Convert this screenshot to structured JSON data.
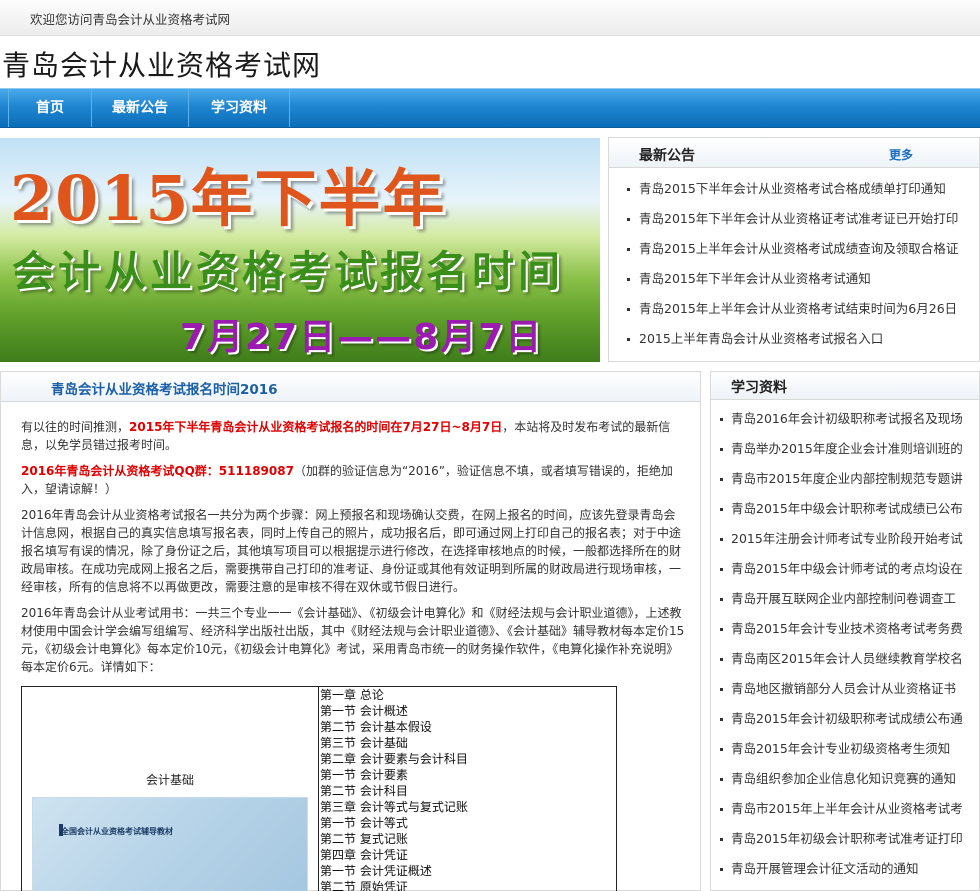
{
  "topbar": {
    "welcome": "欢迎您访问青岛会计从业资格考试网"
  },
  "site": {
    "title": "青岛会计从业资格考试网"
  },
  "nav": {
    "items": [
      "首页",
      "最新公告",
      "学习资料"
    ]
  },
  "banner": {
    "year_text": "2015年下半年",
    "sub_text": "会计从业资格考试报名时间",
    "date_text": "7月27日——8月7日"
  },
  "notice": {
    "title": "最新公告",
    "more": "更多",
    "items": [
      "青岛2015下半年会计从业资格考试合格成绩单打印通知",
      "青岛2015年下半年会计从业资格证考试准考证已开始打印",
      "青岛2015上半年会计从业资格考试成绩查询及领取合格证",
      "青岛2015年下半年会计从业资格考试通知",
      "青岛2015年上半年会计从业资格考试结束时间为6月26日",
      "2015上半年青岛会计从业资格考试报名入口"
    ]
  },
  "article": {
    "title": "青岛会计从业资格考试报名时间2016",
    "p1_pre": "有以往的时间推测，",
    "p1_red": "2015年下半年青岛会计从业资格考试报名的时间在7月27日~8月7日",
    "p1_post": "，本站将及时发布考试的最新信息，以免学员错过报考时间。",
    "p2_red": "2016年青岛会计从资格考试QQ群：511189087",
    "p2_post": "（加群的验证信息为“2016”，验证信息不填，或者填写错误的，拒绝加入，望请谅解！）",
    "p3": "2016年青岛会计从业资格考试报名一共分为两个步骤：网上预报名和现场确认交费，在网上报名的时间，应该先登录青岛会计信息网，根据自己的真实信息填写报名表，同时上传自己的照片，成功报名后，即可通过网上打印自己的报名表；对于中途报名填写有误的情况，除了身份证之后，其他填写项目可以根据提示进行修改，在选择审核地点的时候，一般都选择所在的财政局审核。在成功完成网上报名之后，需要携带自己打印的准考证、身份证或其他有效证明到所属的财政局进行现场审核，一经审核，所有的信息将不以再做更改，需要注意的是审核不得在双休或节假日进行。",
    "p4": "2016年青岛会计从业考试用书：一共三个专业一一《会计基础》、《初级会计电算化》和《财经法规与会计职业道德》，上述教材使用中国会计学会编写组编写、经济科学出版社出版，其中《财经法规与会计职业道德》、《会计基础》辅导教材每本定价15元，《初级会计电算化》每本定价10元，《初级会计电算化》考试，采用青岛市统一的财务操作软件，《电算化操作补充说明》每本定价6元。详情如下：",
    "book": {
      "name": "会计基础",
      "cover_label": "全国会计从业资格考试辅导教材",
      "toc": [
        "第一章 总论",
        "第一节 会计概述",
        "第二节 会计基本假设",
        "第三节 会计基础",
        "第二章 会计要素与会计科目",
        "第一节 会计要素",
        "第二节 会计科目",
        "第三章 会计等式与复式记账",
        "第一节 会计等式",
        "第二节 复式记账",
        "第四章 会计凭证",
        "第一节 会计凭证概述",
        "第二节 原始凭证"
      ]
    }
  },
  "study": {
    "title": "学习资料",
    "items": [
      "青岛2016年会计初级职称考试报名及现场",
      "青岛举办2015年度企业会计准则培训班的",
      "青岛市2015年度企业内部控制规范专题讲",
      "青岛2015年中级会计职称考试成绩已公布",
      "2015年注册会计师考试专业阶段开始考试",
      "青岛2015年中级会计师考试的考点均设在",
      "青岛开展互联网企业内部控制问卷调查工",
      "青岛2015年会计专业技术资格考试考务费",
      "青岛南区2015年会计人员继续教育学校名",
      "青岛地区撤销部分人员会计从业资格证书",
      "青岛2015年会计初级职称考试成绩公布通",
      "青岛2015年会计专业初级资格考生须知",
      "青岛组织参加企业信息化知识竞赛的通知",
      "青岛市2015年上半年会计从业资格考试考",
      "青岛2015年初级会计职称考试准考证打印",
      "青岛开展管理会计征文活动的通知"
    ]
  },
  "colors": {
    "nav_blue": "#1f86d2",
    "link_blue": "#1b6fc2",
    "title_blue": "#1b5fa8",
    "highlight_red": "#e00000"
  }
}
